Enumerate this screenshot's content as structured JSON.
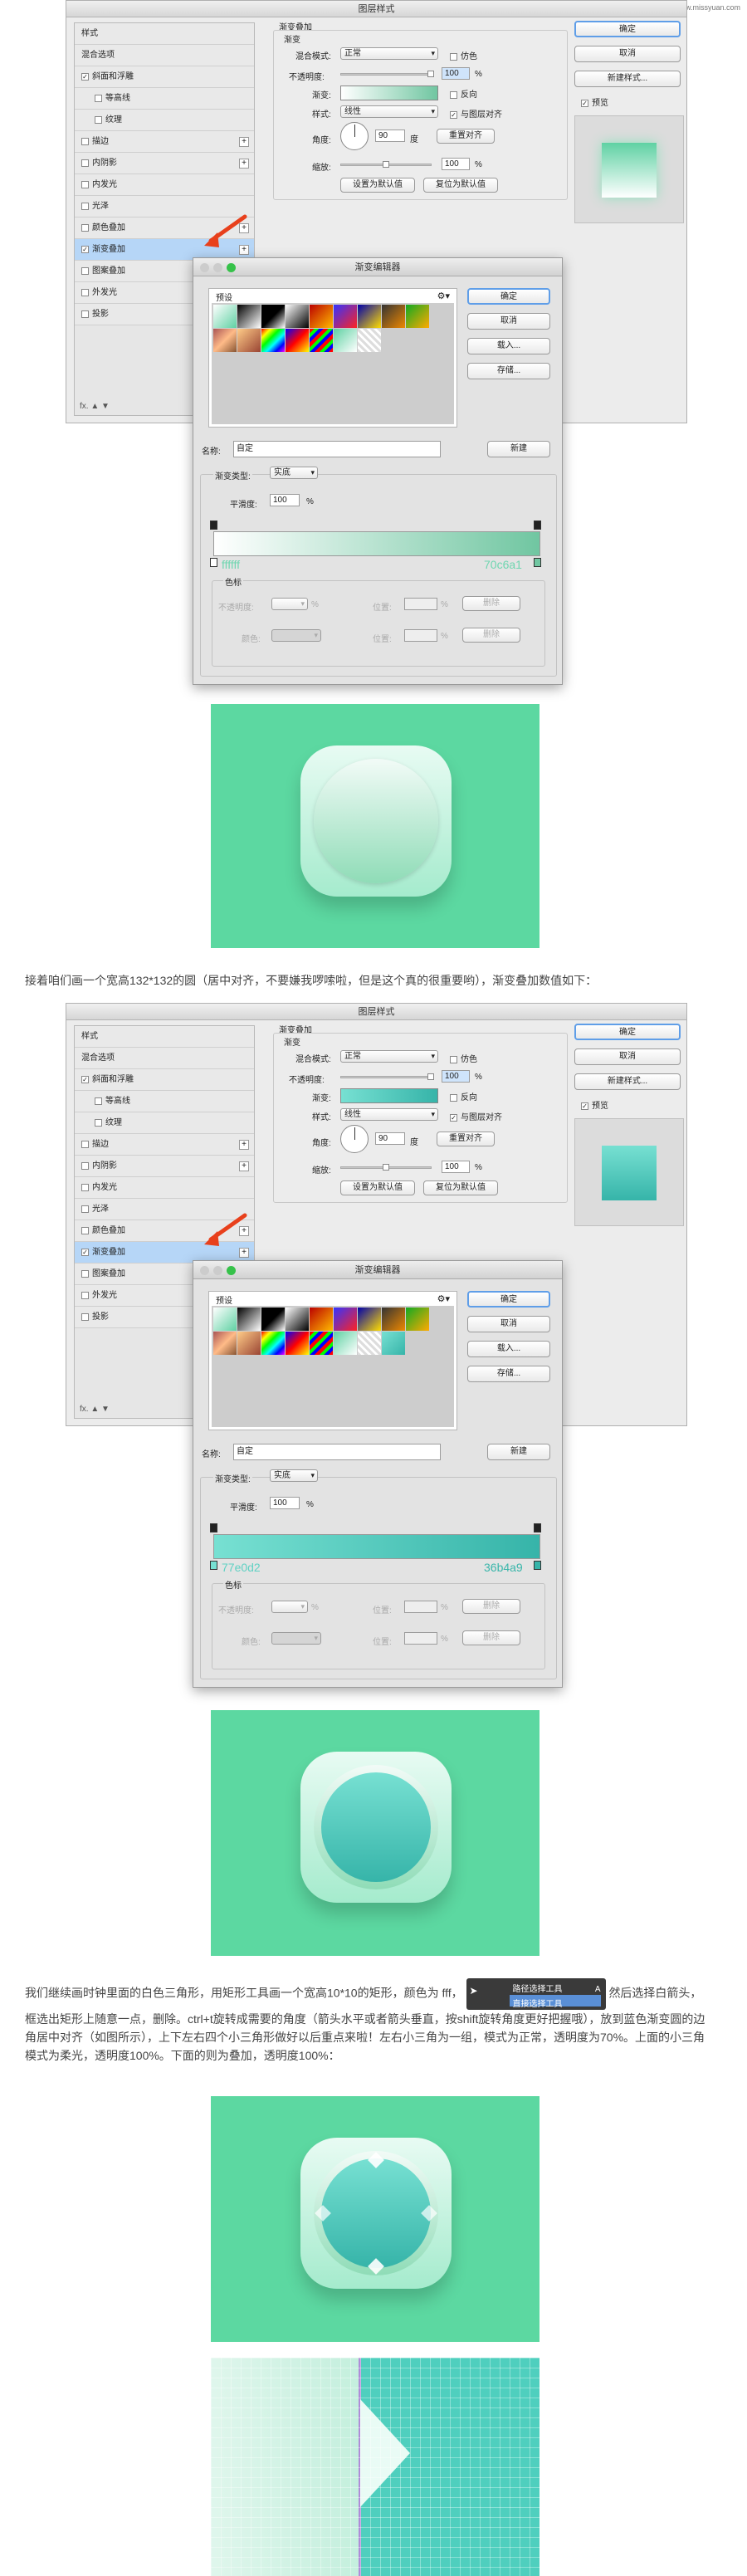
{
  "watermark": "思缘设计论坛 www.missyuan.com",
  "panels": [
    {
      "title": "图层样式",
      "list": [
        "样式",
        "混合选项",
        "斜面和浮雕",
        "等高线",
        "纹理",
        "描边",
        "内阴影",
        "内发光",
        "光泽",
        "颜色叠加",
        "渐变叠加",
        "图案叠加",
        "外发光",
        "投影"
      ],
      "sub": {
        "title": "渐变叠加",
        "group": "渐变",
        "blend_label": "混合模式:",
        "blend_value": "正常",
        "dither": "仿色",
        "opacity_label": "不透明度:",
        "opacity_value": "100",
        "gradient_label": "渐变:",
        "reverse": "反向",
        "style_label": "样式:",
        "style_value": "线性",
        "align": "与图层对齐",
        "angle_label": "角度:",
        "angle_value": "90",
        "angle_unit": "度",
        "reset_align": "重置对齐",
        "scale_label": "缩放:",
        "scale_value": "100",
        "percent": "%",
        "make_default": "设置为默认值",
        "reset_default": "复位为默认值"
      },
      "right": {
        "ok": "确定",
        "cancel": "取消",
        "new_style": "新建样式...",
        "preview": "预览"
      },
      "fx": "fx.",
      "editor": {
        "title": "渐变编辑器",
        "presets": "预设",
        "ok": "确定",
        "cancel": "取消",
        "load": "载入...",
        "save": "存储...",
        "name_label": "名称:",
        "name_value": "自定",
        "new": "新建",
        "type_label": "渐变类型:",
        "type_value": "实底",
        "smooth_label": "平滑度:",
        "smooth_value": "100",
        "stops": "色标",
        "opacity_label": "不透明度:",
        "position_label": "位置:",
        "delete": "删除",
        "color_label": "颜色:",
        "left_color": "ffffff",
        "right_color": "70c6a1"
      }
    },
    {
      "editor": {
        "left_color": "77e0d2",
        "right_color": "36b4a9"
      }
    }
  ],
  "captions": [
    "接着咱们画一个宽高132*132的圆（居中对齐，不要嫌我啰嗦啦，但是这个真的很重要哟），渐变叠加数值如下：",
    "我们继续画时钟里面的白色三角形，用矩形工具画一个宽高10*10的矩形，颜色为 fff，",
    "然后选择白箭头，框选出矩形上随意一点，删除。ctrl+t旋转成需要的角度（箭头水平或者箭头垂直，按shift旋转角度更好把握哦），放到蓝色渐变圆的边角居中对齐（如图所示），上下左右四个小三角形做好以后重点来啦！左右小三角为一组，模式为正常，透明度为70%。上面的小三角模式为柔光，透明度100%。下面的则为叠加，透明度100%："
  ],
  "tool_popup": {
    "item1": "路径选择工具",
    "item2": "直接选择工具",
    "key": "A"
  },
  "colors": {
    "bg_green": "#5cd8a1",
    "stroke_arrow": "#e8401c"
  }
}
